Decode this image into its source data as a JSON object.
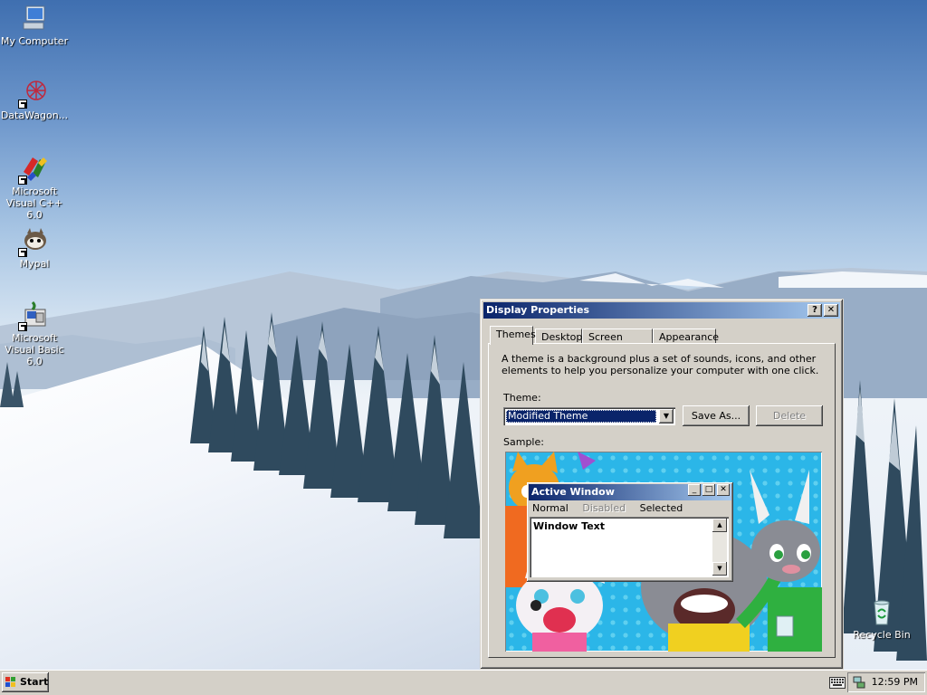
{
  "desktop": {
    "icons": [
      {
        "name": "My Computer",
        "icon": "my-computer-icon"
      },
      {
        "name": "DataWagon...",
        "icon": "datawagon-icon"
      },
      {
        "name": "Microsoft Visual C++ 6.0",
        "icon": "visual-cpp-icon"
      },
      {
        "name": "Mypal",
        "icon": "mypal-icon"
      },
      {
        "name": "Microsoft Visual Basic 6.0",
        "icon": "visual-basic-icon"
      },
      {
        "name": "Recycle Bin",
        "icon": "recycle-bin-icon"
      }
    ]
  },
  "window": {
    "title": "Display Properties",
    "help_btn": "?",
    "close_btn": "✕",
    "tabs": [
      {
        "label": "Themes",
        "active": true
      },
      {
        "label": "Desktop",
        "active": false
      },
      {
        "label": "Screen Saver",
        "active": false
      },
      {
        "label": "Appearance",
        "active": false
      }
    ],
    "description": "A theme is a background plus a set of sounds, icons, and other elements to help you personalize your computer with one click.",
    "theme_label": "Theme:",
    "theme_value": "Modified Theme",
    "save_as_label": "Save As...",
    "delete_label": "Delete",
    "sample_label": "Sample:",
    "sample": {
      "title": "Active Window",
      "menu": [
        "Normal",
        "Disabled",
        "Selected"
      ],
      "text": "Window Text"
    }
  },
  "taskbar": {
    "start_label": "Start",
    "clock": "12:59 PM"
  },
  "colors": {
    "face": "#d4d0c8",
    "title_start": "#0a246a",
    "title_end": "#a6caf0",
    "selection": "#0a246a"
  }
}
